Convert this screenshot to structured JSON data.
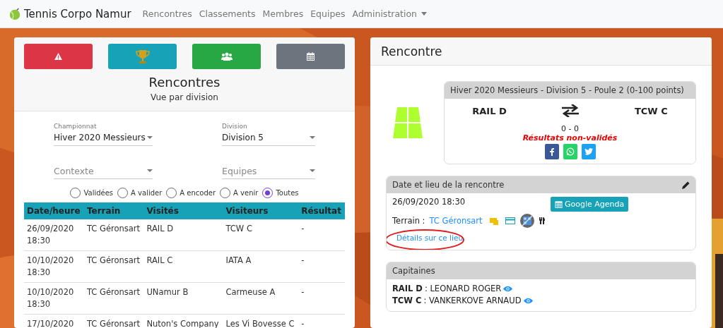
{
  "navbar": {
    "brand": "Tennis Corpo Namur",
    "links": [
      {
        "label": "Rencontres",
        "dropdown": false
      },
      {
        "label": "Classements",
        "dropdown": false
      },
      {
        "label": "Membres",
        "dropdown": false
      },
      {
        "label": "Equipes",
        "dropdown": false
      },
      {
        "label": "Administration",
        "dropdown": true
      }
    ]
  },
  "left_panel": {
    "action_buttons": [
      {
        "kind": "warning",
        "color": "#dc3545"
      },
      {
        "kind": "trophy",
        "color": "#17a2b8"
      },
      {
        "kind": "users",
        "color": "#28a745"
      },
      {
        "kind": "calendar",
        "color": "#6c757d"
      }
    ],
    "title": "Rencontres",
    "subtitle": "Vue par division",
    "filters": [
      {
        "label": "Championnat",
        "value": "Hiver 2020 Messieurs"
      },
      {
        "label": "Division",
        "value": "Division 5"
      },
      {
        "placeholder": "Contexte"
      },
      {
        "placeholder": "Equipes"
      }
    ],
    "radios": [
      {
        "label": "Validées",
        "selected": false
      },
      {
        "label": "A valider",
        "selected": false
      },
      {
        "label": "A encoder",
        "selected": false
      },
      {
        "label": "A venir",
        "selected": false
      },
      {
        "label": "Toutes",
        "selected": true
      }
    ],
    "table": {
      "columns": [
        "Date/heure",
        "Terrain",
        "Visités",
        "Visiteurs",
        "Résultat"
      ],
      "rows": [
        {
          "date": "26/09/2020",
          "time": "18:30",
          "terrain": "TC Géronsart",
          "visites": "RAIL D",
          "visiteurs": "TCW C",
          "resultat": "-"
        },
        {
          "date": "10/10/2020",
          "time": "18:30",
          "terrain": "TC Géronsart",
          "visites": "RAIL C",
          "visiteurs": "IATA A",
          "resultat": "-"
        },
        {
          "date": "10/10/2020",
          "time": "18:30",
          "terrain": "TC Géronsart",
          "visites": "UNamur B",
          "visiteurs": "Carmeuse A",
          "resultat": "-"
        },
        {
          "date": "17/10/2020",
          "terrain": "TC Géronsart",
          "visites": "Nuton's Company",
          "visiteurs": "Les Vi Bovesse C",
          "resultat": "-"
        }
      ]
    }
  },
  "right_panel": {
    "title": "Rencontre",
    "match": {
      "header": "Hiver 2020 Messieurs - Division 5 - Poule 2 (0-100 points)",
      "home": "RAIL D",
      "away": "TCW C",
      "score": "0 - 0",
      "status": "Résultats non-validés",
      "share": [
        {
          "kind": "facebook",
          "color": "#3b5998"
        },
        {
          "kind": "whatsapp",
          "color": "#25d366"
        },
        {
          "kind": "twitter",
          "color": "#1da1f2"
        }
      ]
    },
    "venue": {
      "header": "Date et lieu de la rencontre",
      "datetime": "26/09/2020 18:30",
      "agenda_button": "Google Agenda",
      "terrain_label": "Terrain :",
      "terrain": "TC Géronsart",
      "details_link": "Détails sur ce lieu",
      "details_circled": true
    },
    "captains": {
      "header": "Capitaines",
      "rows": [
        {
          "team": "RAIL D",
          "name": ": LEONARD ROGER"
        },
        {
          "team": "TCW C",
          "name": ": VANKERKOVE ARNAUD"
        }
      ]
    }
  }
}
